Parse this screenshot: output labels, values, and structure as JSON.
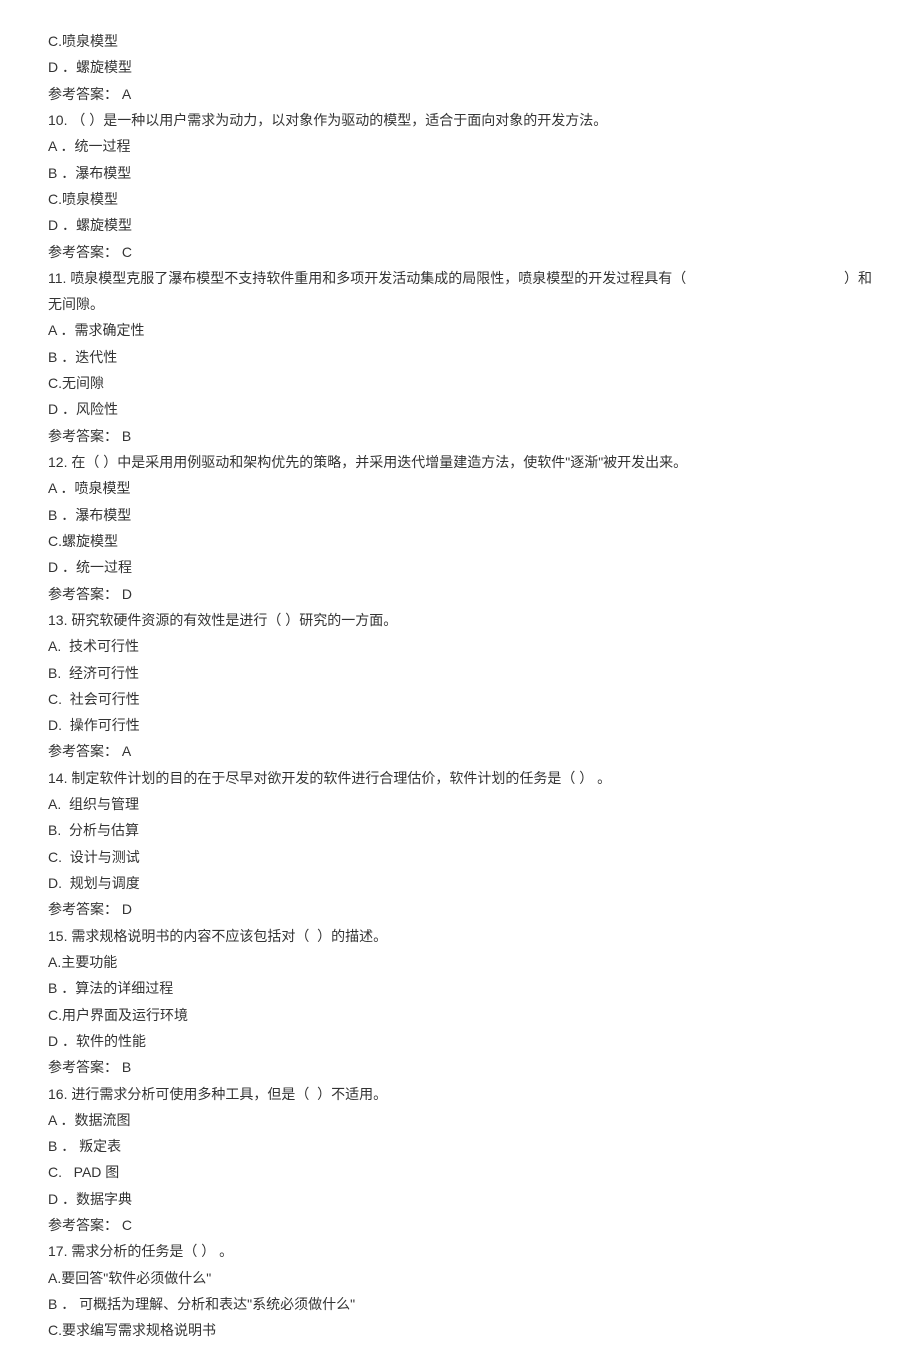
{
  "q9": {
    "optC": "C.喷泉模型",
    "optD": "D ．螺旋模型",
    "answer": "参考答案： A"
  },
  "q10": {
    "stem": "10. （ ）是一种以用户需求为动力，以对象作为驱动的模型，适合于面向对象的开发方法。",
    "optA": "A ．统一过程",
    "optB": "B ．瀑布模型",
    "optC": "C.喷泉模型",
    "optD": "D ．螺旋模型",
    "answer": "参考答案： C"
  },
  "q11": {
    "stem_left": "11. 喷泉模型克服了瀑布模型不支持软件重用和多项开发活动集成的局限性，喷泉模型的开发过程具有（",
    "stem_right": "）和",
    "stem_line2": "无间隙。",
    "optA": "A ．需求确定性",
    "optB": "B ．迭代性",
    "optC": "C.无间隙",
    "optD": "D ．风险性",
    "answer": "参考答案： B"
  },
  "q12": {
    "stem": "12. 在（ ）中是采用用例驱动和架构优先的策略，并采用迭代增量建造方法，使软件\"逐渐\"被开发出来。",
    "optA": "A ．喷泉模型",
    "optB": "B ．瀑布模型",
    "optC": "C.螺旋模型",
    "optD": "D ．统一过程",
    "answer": "参考答案： D"
  },
  "q13": {
    "stem": "13. 研究软硬件资源的有效性是进行（ ）研究的一方面。",
    "optA": "A.  技术可行性",
    "optB": "B.  经济可行性",
    "optC": "C.  社会可行性",
    "optD": "D.  操作可行性",
    "answer": "参考答案： A"
  },
  "q14": {
    "stem": "14. 制定软件计划的目的在于尽早对欲开发的软件进行合理估价，软件计划的任务是（ ） 。",
    "optA": "A.  组织与管理",
    "optB": "B.  分析与估算",
    "optC": "C.  设计与测试",
    "optD": "D.  规划与调度",
    "answer": "参考答案： D"
  },
  "q15": {
    "stem": "15. 需求规格说明书的内容不应该包括对（  ）的描述。",
    "optA": "A.主要功能",
    "optB": "B ．算法的详细过程",
    "optC": "C.用户界面及运行环境",
    "optD": "D ．软件的性能",
    "answer": "参考答案： B"
  },
  "q16": {
    "stem": "16. 进行需求分析可使用多种工具，但是（  ）不适用。",
    "optA": "A ．数据流图",
    "optB": "B ． 叛定表",
    "optC": "C.   PAD 图",
    "optD": "D ．数据字典",
    "answer": "参考答案： C"
  },
  "q17": {
    "stem": "17. 需求分析的任务是（ ） 。",
    "optA": "A.要回答\"软件必须做什么\"",
    "optB": "B ． 可概括为理解、分析和表达\"系统必须做什么\"",
    "optC": "C.要求编写需求规格说明书"
  }
}
